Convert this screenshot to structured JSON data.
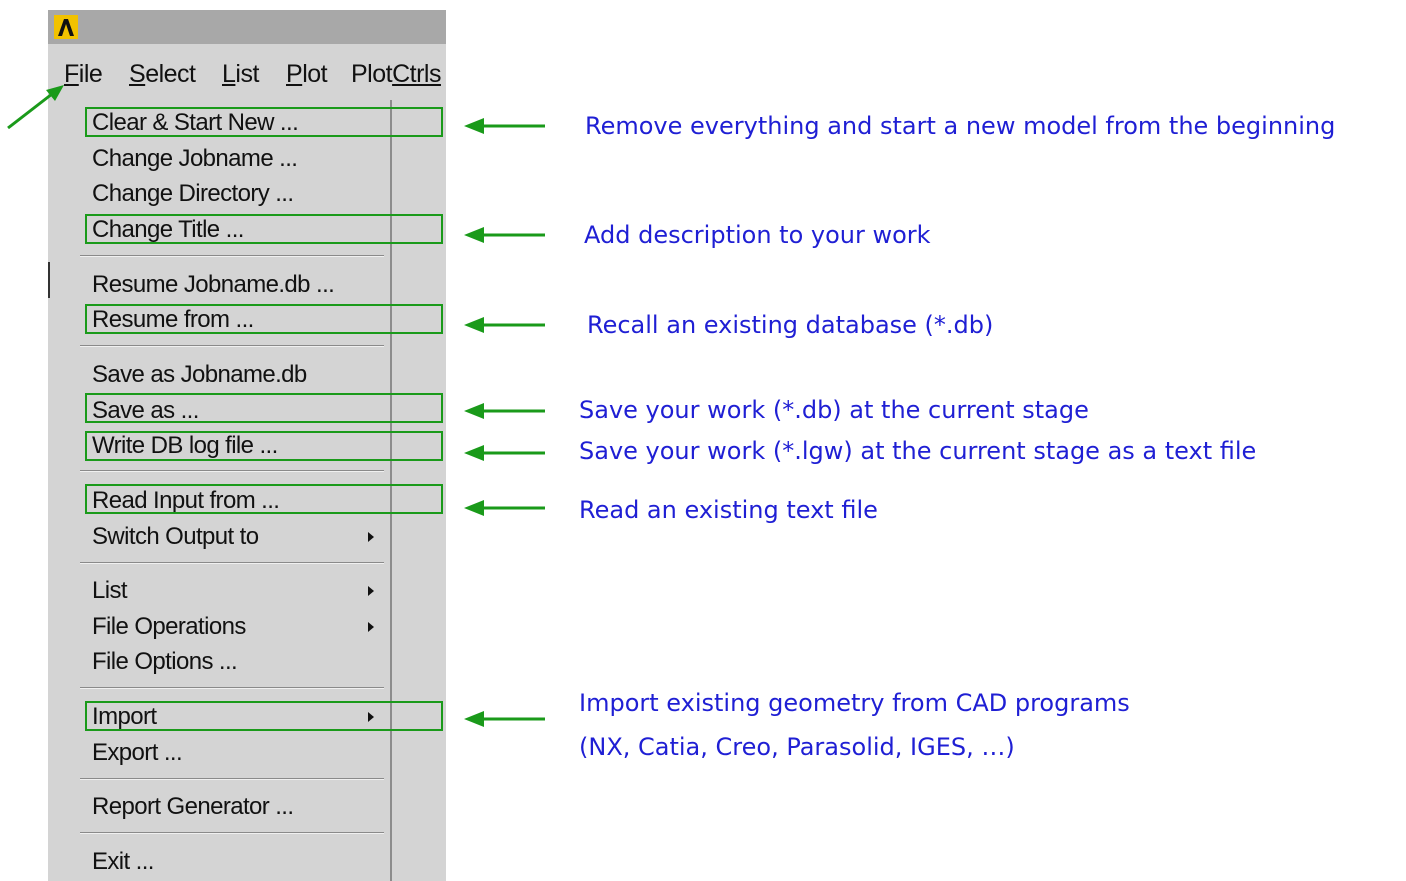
{
  "app": {
    "logo": "ansys-logo"
  },
  "menubar": {
    "items": [
      {
        "first": "F",
        "rest": "ile"
      },
      {
        "first": "S",
        "rest": "elect"
      },
      {
        "first": "L",
        "rest": "ist"
      },
      {
        "first": "P",
        "rest": "lot"
      },
      {
        "first": "Plot",
        "rest": "Ctrls"
      }
    ]
  },
  "file_menu": {
    "items": [
      "Clear & Start New ...",
      "Change Jobname ...",
      "Change Directory ...",
      "Change Title ...",
      "Resume Jobname.db ...",
      "Resume from ...",
      "Save as Jobname.db",
      "Save as ...",
      "Write DB log file ...",
      "Read Input from ...",
      "Switch Output to",
      "List",
      "File Operations",
      "File Options ...",
      "Import",
      "Export ...",
      "Report Generator ...",
      "Exit ..."
    ]
  },
  "annotations": [
    "Remove everything and start a new model from the beginning",
    "Add description to your work",
    "Recall an existing database (*.db)",
    "Save your work (*.db) at the current stage",
    "Save your work (*.lgw) at the current stage as a text file",
    "Read an existing text file",
    "Import existing geometry from CAD programs",
    "(NX, Catia, Creo, Parasolid, IGES, …)"
  ],
  "colors": {
    "highlight_box": "#1a9a1a",
    "arrow": "#1a9a1a",
    "annotation_text": "#1f1fd4",
    "menu_background": "#d4d4d4",
    "title_bar": "#a8a8a8"
  }
}
